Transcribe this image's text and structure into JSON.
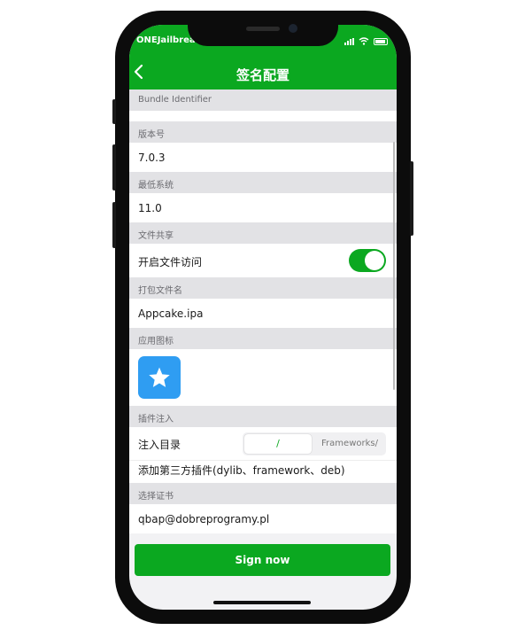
{
  "status_bar": {
    "carrier": "ONEJailbreak"
  },
  "nav": {
    "title": "签名配置"
  },
  "sections": {
    "bundle": "Bundle Identifier",
    "version": "版本号",
    "min_os": "最低系统",
    "file_sharing": "文件共享",
    "package_name": "打包文件名",
    "app_icon": "应用图标",
    "plugin_inject": "插件注入",
    "certificate": "选择证书"
  },
  "values": {
    "version": "7.0.3",
    "min_os": "11.0",
    "file_sharing_label": "开启文件访问",
    "file_sharing_on": true,
    "package_name": "Appcake.ipa",
    "inject_dir_label": "注入目录",
    "inject_dir_options": [
      "/",
      "Frameworks/"
    ],
    "inject_dir_selected": "/",
    "add_plugin": "添加第三方插件(dylib、framework、deb)",
    "certificate": "qbap@dobreprogramy.pl"
  },
  "actions": {
    "sign": "Sign now"
  },
  "colors": {
    "accent": "#0ba820",
    "icon_bg": "#2f9df2"
  },
  "icons": {
    "back": "chevron-left-icon",
    "app": "star-icon"
  }
}
